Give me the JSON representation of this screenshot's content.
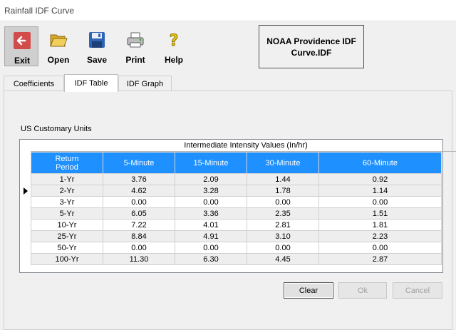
{
  "window": {
    "title": "Rainfall IDF Curve"
  },
  "toolbar": {
    "exit_label": "Exit",
    "open_label": "Open",
    "save_label": "Save",
    "print_label": "Print",
    "help_label": "Help",
    "file_name": "NOAA Providence IDF Curve.IDF"
  },
  "tabs": [
    {
      "label": "Coefficients"
    },
    {
      "label": "IDF Table"
    },
    {
      "label": "IDF Graph"
    }
  ],
  "active_tab": "IDF Table",
  "units_label": "US Customary Units",
  "grid": {
    "caption": "Intermediate Intensity Values (In/hr)",
    "headers": [
      "Return Period",
      "5-Minute",
      "15-Minute",
      "30-Minute",
      "60-Minute"
    ],
    "rows": [
      [
        "1-Yr",
        "3.76",
        "2.09",
        "1.44",
        "0.92"
      ],
      [
        "2-Yr",
        "4.62",
        "3.28",
        "1.78",
        "1.14"
      ],
      [
        "3-Yr",
        "0.00",
        "0.00",
        "0.00",
        "0.00"
      ],
      [
        "5-Yr",
        "6.05",
        "3.36",
        "2.35",
        "1.51"
      ],
      [
        "10-Yr",
        "7.22",
        "4.01",
        "2.81",
        "1.81"
      ],
      [
        "25-Yr",
        "8.84",
        "4.91",
        "3.10",
        "2.23"
      ],
      [
        "50-Yr",
        "0.00",
        "0.00",
        "0.00",
        "0.00"
      ],
      [
        "100-Yr",
        "11.30",
        "6.30",
        "4.45",
        "2.87"
      ]
    ],
    "current_row": "2-Yr"
  },
  "buttons": {
    "clear_label": "Clear",
    "ok_label": "Ok",
    "cancel_label": "Cancel"
  },
  "colors": {
    "header_bg": "#1e90ff",
    "exit_icon": "#d24c4c"
  }
}
